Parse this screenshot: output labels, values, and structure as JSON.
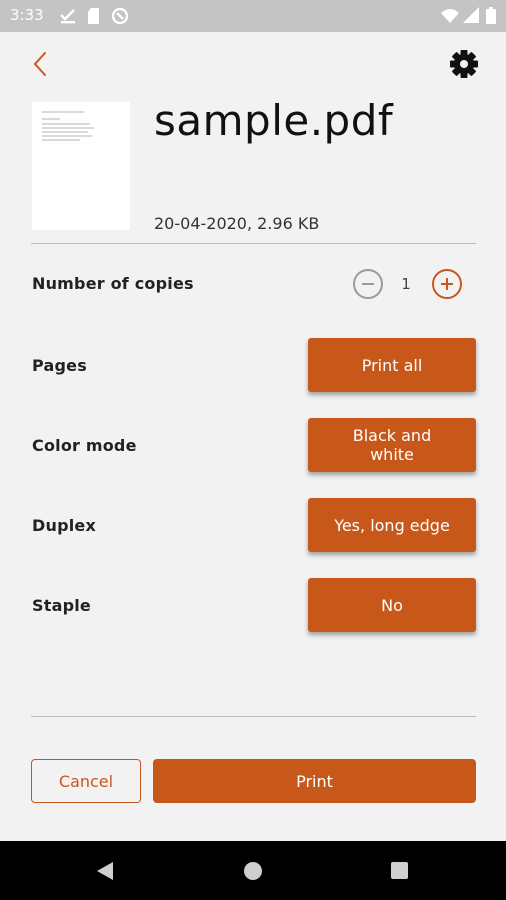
{
  "status_bar": {
    "time": "3:33",
    "icons": [
      "download-done-icon",
      "sd-card-icon",
      "sync-icon",
      "wifi-icon",
      "signal-icon",
      "battery-icon"
    ]
  },
  "header": {
    "back_icon": "chevron-left-icon",
    "settings_icon": "gear-icon"
  },
  "file": {
    "name": "sample.pdf",
    "meta": "20-04-2020, 2.96 KB"
  },
  "options": {
    "copies": {
      "label": "Number of copies",
      "value": "1"
    },
    "pages": {
      "label": "Pages",
      "value": "Print all"
    },
    "color_mode": {
      "label": "Color mode",
      "value": "Black and white"
    },
    "duplex": {
      "label": "Duplex",
      "value": "Yes, long edge"
    },
    "staple": {
      "label": "Staple",
      "value": "No"
    }
  },
  "actions": {
    "cancel": "Cancel",
    "print": "Print"
  },
  "colors": {
    "accent": "#c8581a",
    "background": "#f2f2f2",
    "status_bar": "#c4c4c4",
    "nav_bar": "#000000"
  }
}
